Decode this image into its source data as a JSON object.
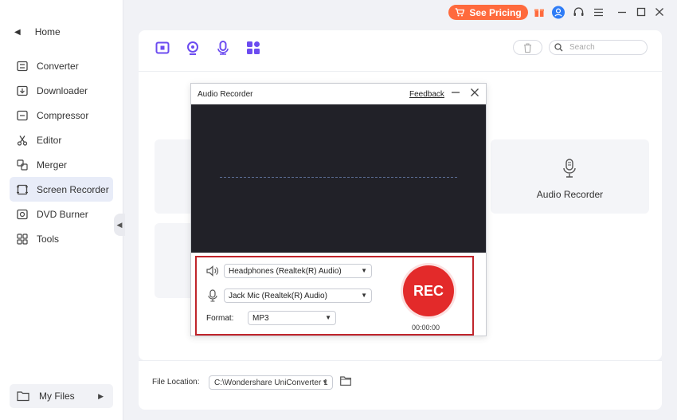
{
  "sidebar": {
    "home_label": "Home",
    "items": [
      {
        "label": "Converter",
        "icon": "converter-icon"
      },
      {
        "label": "Downloader",
        "icon": "downloader-icon"
      },
      {
        "label": "Compressor",
        "icon": "compressor-icon"
      },
      {
        "label": "Editor",
        "icon": "editor-icon"
      },
      {
        "label": "Merger",
        "icon": "merger-icon"
      },
      {
        "label": "Screen Recorder",
        "icon": "screen-recorder-icon",
        "active": true
      },
      {
        "label": "DVD Burner",
        "icon": "dvd-icon"
      },
      {
        "label": "Tools",
        "icon": "tools-icon"
      }
    ],
    "my_files_label": "My Files"
  },
  "titlebar": {
    "pricing_label": "See Pricing",
    "accent": "#ff6a3d"
  },
  "main": {
    "search_placeholder": "Search",
    "audio_card_label": "Audio Recorder"
  },
  "footer": {
    "file_location_label": "File Location:",
    "path_value": "C:\\Wondershare UniConverter 1"
  },
  "dialog": {
    "title": "Audio Recorder",
    "feedback_label": "Feedback",
    "speaker_device": "Headphones (Realtek(R) Audio)",
    "mic_device": "Jack Mic (Realtek(R) Audio)",
    "format_label": "Format:",
    "format_value": "MP3",
    "rec_label": "REC",
    "timer": "00:00:00",
    "rec_color": "#e32a2a"
  }
}
